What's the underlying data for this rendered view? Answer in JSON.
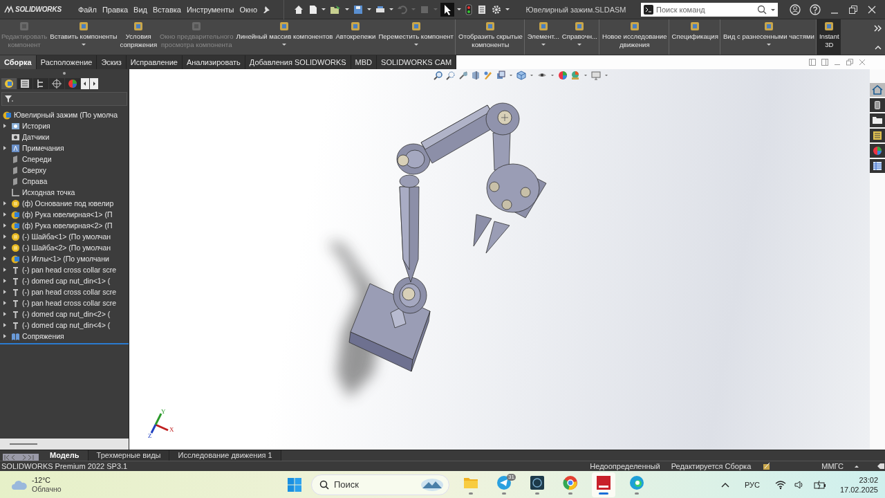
{
  "title_bar": {
    "logo": "SOLIDWORKS",
    "menu": [
      "Файл",
      "Правка",
      "Вид",
      "Вставка",
      "Инструменты",
      "Окно"
    ],
    "document_title": "Ювелирный зажим.SLDASM",
    "search": {
      "placeholder": "Поиск команд"
    }
  },
  "ribbon": {
    "commands": [
      {
        "label": "Редактировать\nкомпонент",
        "disabled": true,
        "dropdown": false,
        "separator_before": false,
        "on": false
      },
      {
        "label": "Вставить компоненты",
        "disabled": false,
        "dropdown": true,
        "separator_before": false,
        "on": false
      },
      {
        "label": "Условия\nсопряжения",
        "disabled": false,
        "dropdown": false,
        "separator_before": false,
        "on": false
      },
      {
        "label": "Окно предварительного\nпросмотра компонента",
        "disabled": true,
        "dropdown": false,
        "separator_before": false,
        "on": false
      },
      {
        "label": "Линейный массив компонентов",
        "disabled": false,
        "dropdown": true,
        "separator_before": false,
        "on": false
      },
      {
        "label": "Автокрепежи",
        "disabled": false,
        "dropdown": false,
        "separator_before": false,
        "on": false
      },
      {
        "label": "Переместить компонент",
        "disabled": false,
        "dropdown": true,
        "separator_before": false,
        "on": false
      },
      {
        "label": "Отобразить скрытые\nкомпоненты",
        "disabled": false,
        "dropdown": false,
        "separator_before": true,
        "on": false
      },
      {
        "label": "Элемент...",
        "disabled": false,
        "dropdown": true,
        "separator_before": true,
        "on": false
      },
      {
        "label": "Справочн...",
        "disabled": false,
        "dropdown": true,
        "separator_before": false,
        "on": false
      },
      {
        "label": "Новое исследование\nдвижения",
        "disabled": false,
        "dropdown": false,
        "separator_before": true,
        "on": false
      },
      {
        "label": "Спецификация",
        "disabled": false,
        "dropdown": false,
        "separator_before": true,
        "on": false
      },
      {
        "label": "Вид с разнесенными частями",
        "disabled": false,
        "dropdown": true,
        "separator_before": true,
        "on": false
      },
      {
        "label": "Instant\n3D",
        "disabled": false,
        "dropdown": false,
        "separator_before": true,
        "on": true
      }
    ]
  },
  "tabs": [
    {
      "label": "Сборка",
      "selected": true
    },
    {
      "label": "Расположение",
      "selected": false
    },
    {
      "label": "Эскиз",
      "selected": false
    },
    {
      "label": "Исправление",
      "selected": false
    },
    {
      "label": "Анализировать",
      "selected": false
    },
    {
      "label": "Добавления SOLIDWORKS",
      "selected": false
    },
    {
      "label": "MBD",
      "selected": false
    },
    {
      "label": "SOLIDWORKS CAM",
      "selected": false
    }
  ],
  "feature_tree": {
    "root": {
      "label": "Ювелирный зажим (По умолча",
      "kind": "assembly",
      "children": [
        {
          "label": "История",
          "kind": "history",
          "expanded": false
        },
        {
          "label": "Датчики",
          "kind": "sensors"
        },
        {
          "label": "Примечания",
          "kind": "annotations",
          "expanded": false
        },
        {
          "label": "Спереди",
          "kind": "plane"
        },
        {
          "label": "Сверху",
          "kind": "plane"
        },
        {
          "label": "Справа",
          "kind": "plane"
        },
        {
          "label": "Исходная точка",
          "kind": "origin"
        },
        {
          "label": "(ф) Основание под ювелир",
          "kind": "part",
          "expanded": false
        },
        {
          "label": "(ф) Рука ювелирная<1> (П",
          "kind": "assembly",
          "expanded": false
        },
        {
          "label": "(ф) Рука ювелирная<2> (П",
          "kind": "assembly",
          "expanded": false
        },
        {
          "label": "(-) Шайба<1> (По умолчан",
          "kind": "part",
          "expanded": false
        },
        {
          "label": "(-) Шайба<2> (По умолчан",
          "kind": "part",
          "expanded": false
        },
        {
          "label": "(-) Иглы<1> (По умолчани",
          "kind": "assembly",
          "expanded": false
        },
        {
          "label": "(-) pan head cross collar scre",
          "kind": "fastener",
          "expanded": false
        },
        {
          "label": "(-) domed cap nut_din<1> (",
          "kind": "fastener",
          "expanded": false
        },
        {
          "label": "(-) pan head cross collar scre",
          "kind": "fastener",
          "expanded": false
        },
        {
          "label": "(-) pan head cross collar scre",
          "kind": "fastener",
          "expanded": false
        },
        {
          "label": "(-) domed cap nut_din<2> (",
          "kind": "fastener",
          "expanded": false
        },
        {
          "label": "(-) domed cap nut_din<4> (",
          "kind": "fastener",
          "expanded": false
        },
        {
          "label": "Сопряжения",
          "kind": "mates",
          "expanded": false
        }
      ]
    }
  },
  "viewport": {
    "triad": {
      "x": "X",
      "y": "Y",
      "z": "Z"
    }
  },
  "bottom_tabs": [
    {
      "label": "Модель",
      "selected": true
    },
    {
      "label": "Трехмерные виды",
      "selected": false
    },
    {
      "label": "Исследование движения 1",
      "selected": false
    }
  ],
  "status_bar": {
    "product": "SOLIDWORKS Premium 2022 SP3.1",
    "definition": "Недоопределенный",
    "mode": "Редактируется Сборка",
    "units": "ММГС"
  },
  "taskbar": {
    "weather": {
      "temperature": "-12°C",
      "condition": "Облачно"
    },
    "search": {
      "placeholder": "Поиск"
    },
    "apps": [
      {
        "kind": "files",
        "active": false
      },
      {
        "kind": "messenger",
        "active": false,
        "badge": "31"
      },
      {
        "kind": "utility",
        "active": false
      },
      {
        "kind": "browser",
        "active": false
      },
      {
        "kind": "cad",
        "active": true
      },
      {
        "kind": "edge",
        "active": false
      }
    ],
    "language": "РУС",
    "time": "23:02",
    "date": "17.02.2025"
  }
}
